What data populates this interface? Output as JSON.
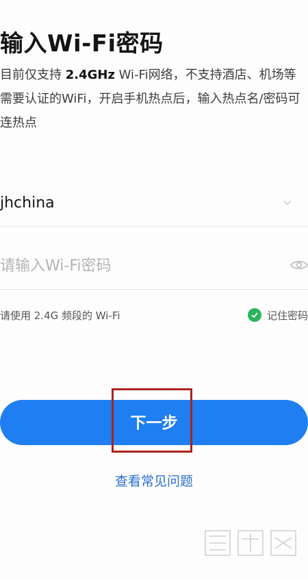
{
  "page": {
    "title": "输入Wi-Fi密码",
    "desc_pre": "目前仅支持 ",
    "desc_bold": "2.4GHz",
    "desc_post": " Wi-Fi网络，不支持酒店、机场等需要认证的WiFi，开启手机热点后，输入热点名/密码可连热点"
  },
  "form": {
    "ssid_value": "jhchina",
    "password_placeholder": "请输入Wi-Fi密码",
    "password_value": "",
    "band_hint": "请使用 2.4G 频段的 Wi-Fi",
    "remember_label": "记住密码",
    "remember_checked": true
  },
  "actions": {
    "next_label": "下一步",
    "faq_label": "查看常见问题"
  },
  "colors": {
    "primary": "#1f7ef2",
    "check": "#2bb55a",
    "link": "#2a6fd0",
    "annotation": "#a8241c"
  },
  "icons": {
    "dropdown": "chevron-down-icon",
    "password_visibility": "eye-icon",
    "remember": "check-circle-icon"
  }
}
